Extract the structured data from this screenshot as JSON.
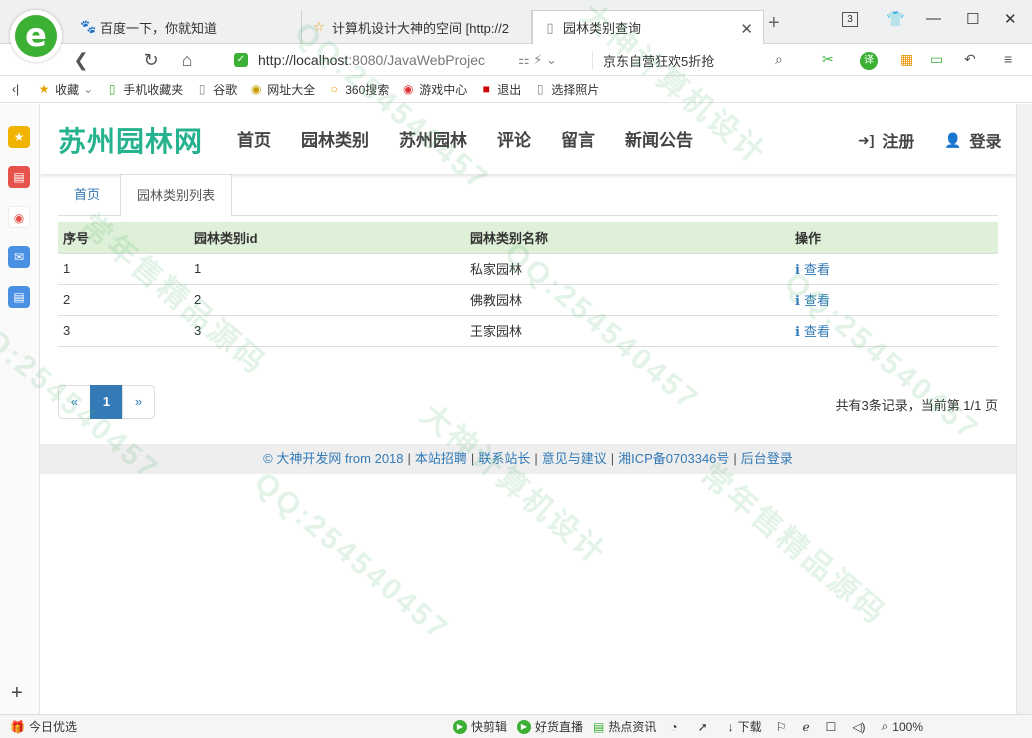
{
  "browser": {
    "tabs": [
      {
        "title": "百度一下，你就知道",
        "icon": "paw-icon"
      },
      {
        "title": "计算机设计大神的空间 [http://2",
        "icon": "star-icon"
      },
      {
        "title": "园林类别查询",
        "icon": "page-icon"
      }
    ],
    "tab_count": "3",
    "url_host": "http://localhost",
    "url_rest": ":8080/JavaWebProjec",
    "promo": "京东自营狂欢5折抢",
    "translate_label": "译"
  },
  "bookmarks": [
    {
      "label": "收藏",
      "icon": "star-icon"
    },
    {
      "label": "手机收藏夹",
      "icon": "phone-icon"
    },
    {
      "label": "谷歌",
      "icon": "page-icon"
    },
    {
      "label": "网址大全",
      "icon": "globe-icon"
    },
    {
      "label": "360搜索",
      "icon": "search-icon"
    },
    {
      "label": "游戏中心",
      "icon": "game-icon"
    },
    {
      "label": "退出",
      "icon": "exit-icon"
    },
    {
      "label": "选择照片",
      "icon": "page-icon"
    }
  ],
  "site": {
    "logo": "苏州园林网",
    "nav": [
      "首页",
      "园林类别",
      "苏州园林",
      "评论",
      "留言",
      "新闻公告"
    ],
    "register": "注册",
    "login": "登录"
  },
  "crumbs": {
    "home": "首页",
    "current": "园林类别列表"
  },
  "table": {
    "headers": [
      "序号",
      "园林类别id",
      "园林类别名称",
      "操作"
    ],
    "rows": [
      {
        "no": "1",
        "id": "1",
        "name": "私家园林",
        "action": "查看"
      },
      {
        "no": "2",
        "id": "2",
        "name": "佛教园林",
        "action": "查看"
      },
      {
        "no": "3",
        "id": "3",
        "name": "王家园林",
        "action": "查看"
      }
    ]
  },
  "pagination": {
    "prev": "«",
    "current": "1",
    "next": "»",
    "summary": "共有3条记录，当前第 1/1 页"
  },
  "footer": {
    "links": [
      "© 大神开发网 from 2018",
      "本站招聘",
      "联系站长",
      "意见与建议",
      "湘ICP备0703346号",
      "后台登录"
    ]
  },
  "watermark": {
    "texts": [
      "QQ:254540457",
      "大神计算机设计",
      "常年售精品源码"
    ]
  },
  "statusbar": {
    "left": "今日优选",
    "items": [
      "快剪辑",
      "好货直播",
      "热点资讯",
      "下载"
    ],
    "zoom": "100%"
  }
}
